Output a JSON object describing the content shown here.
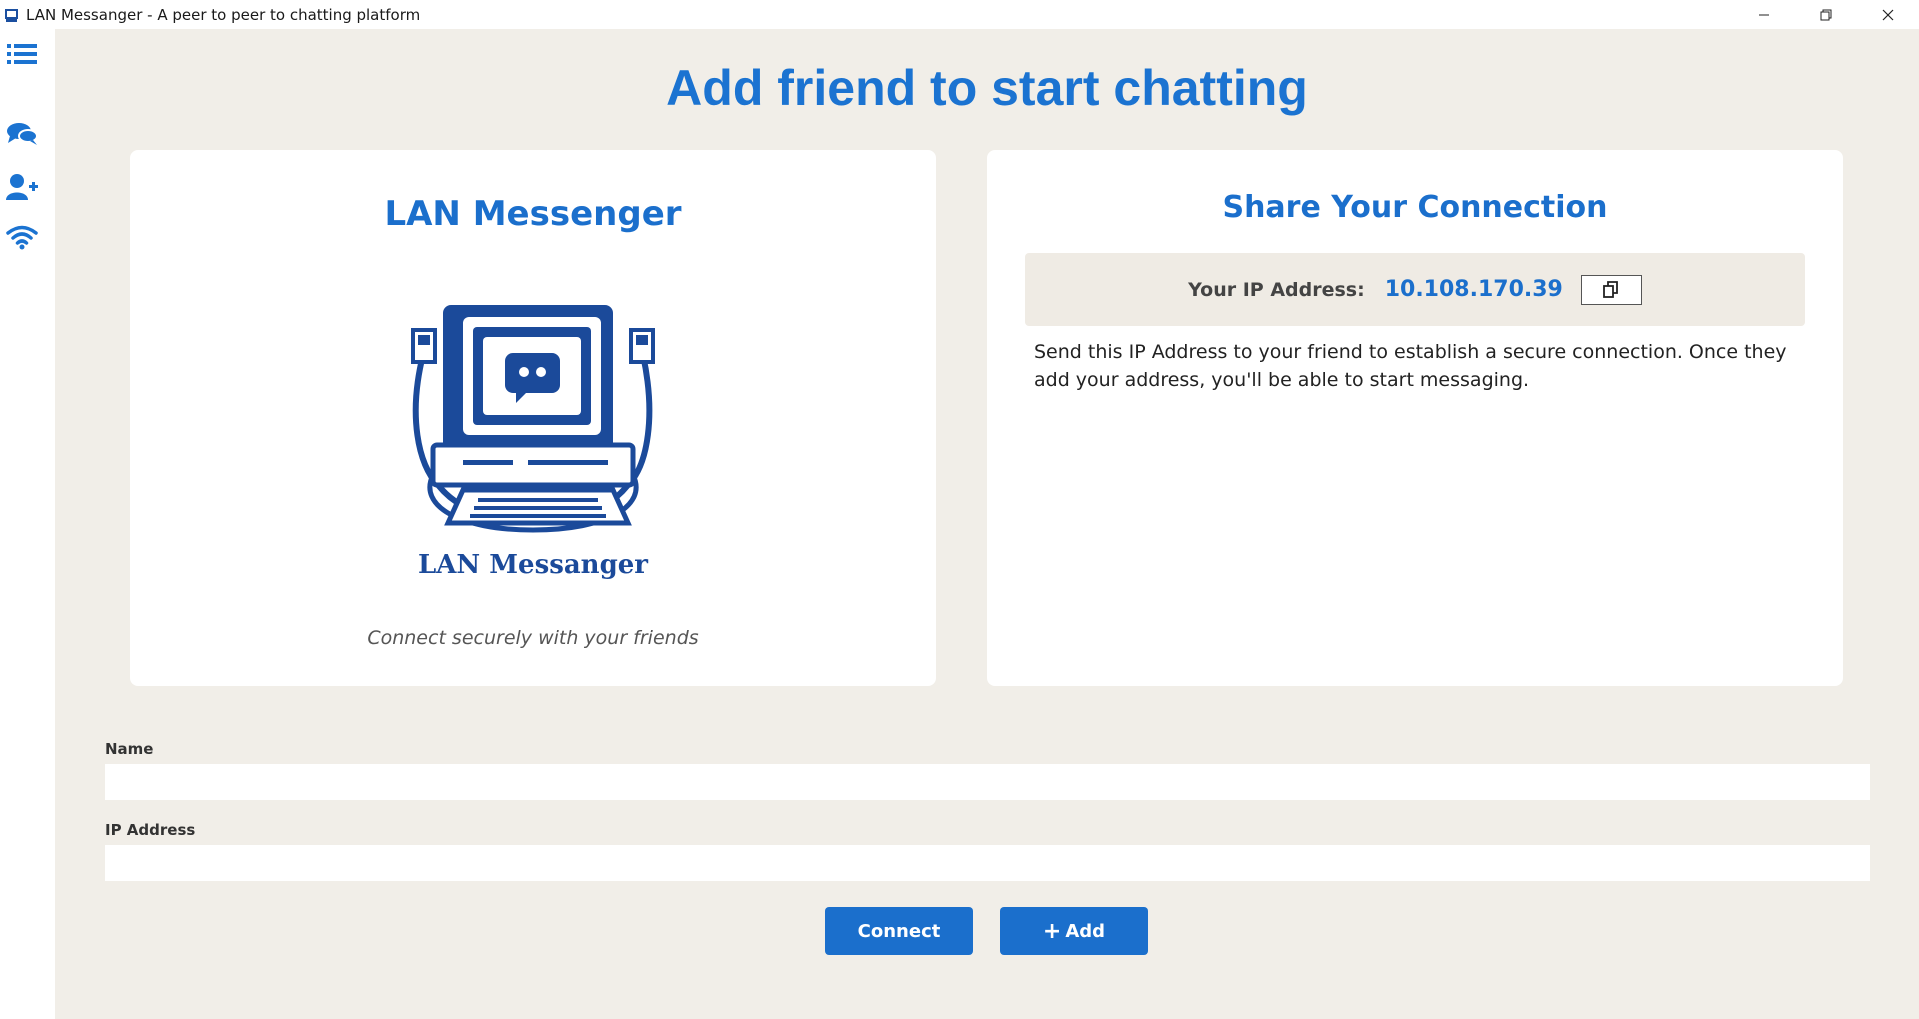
{
  "window": {
    "title": "LAN Messanger - A peer to peer to chatting platform"
  },
  "sidebar": {
    "items": [
      {
        "icon": "list-icon"
      },
      {
        "icon": "chat-icon"
      },
      {
        "icon": "add-user-icon"
      },
      {
        "icon": "wifi-icon"
      }
    ]
  },
  "main": {
    "title": "Add friend to start chatting",
    "left_card": {
      "heading": "LAN Messenger",
      "logo_text": "LAN Messanger",
      "caption": "Connect securely with your friends"
    },
    "right_card": {
      "heading": "Share Your Connection",
      "ip_label": "Your IP Address:",
      "ip_value": "10.108.170.39",
      "description": "Send this IP Address to your friend to establish a secure connection. Once they add your address, you'll be able to start messaging."
    },
    "form": {
      "name_label": "Name",
      "name_value": "",
      "ip_label": "IP Address",
      "ip_value": ""
    },
    "buttons": {
      "connect": "Connect",
      "add": "Add",
      "add_prefix": "+"
    }
  },
  "colors": {
    "accent": "#1b73d1",
    "background": "#f1eee8"
  }
}
